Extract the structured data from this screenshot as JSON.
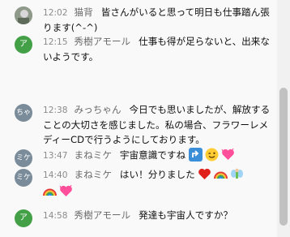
{
  "messages": [
    {
      "time": "12:02",
      "author": "猫背",
      "text": "皆さんがいると思って明日も仕事踏ん張ります(^-^)",
      "avatar_letter": ""
    },
    {
      "time": "12:15",
      "author": "秀樹アモール",
      "text": "仕事も得が足らないと、出来ないようです。",
      "avatar_letter": "ア"
    },
    {
      "time": "12:38",
      "author": "みっちゃん",
      "text": "今日でも思いましたが、解放することの大切さを感じました。私の場合、フラワーレメディーCDで行うようにしております。",
      "avatar_letter": "ちゃ"
    },
    {
      "time": "13:47",
      "author": "まねミケ",
      "text": "宇宙意識ですね",
      "avatar_letter": "ミケ"
    },
    {
      "time": "14:40",
      "author": "まねミケ",
      "text": "はい！分りました",
      "avatar_letter": "ミケ"
    },
    {
      "time": "14:58",
      "author": "秀樹アモール",
      "text": "発達も宇宙人ですか？",
      "avatar_letter": "ア"
    }
  ],
  "colors": {
    "green_avatar": "#43a047",
    "gray_avatar": "#7a8b9a",
    "heart": "#ff4f9a",
    "red_heart": "#e0201a"
  }
}
